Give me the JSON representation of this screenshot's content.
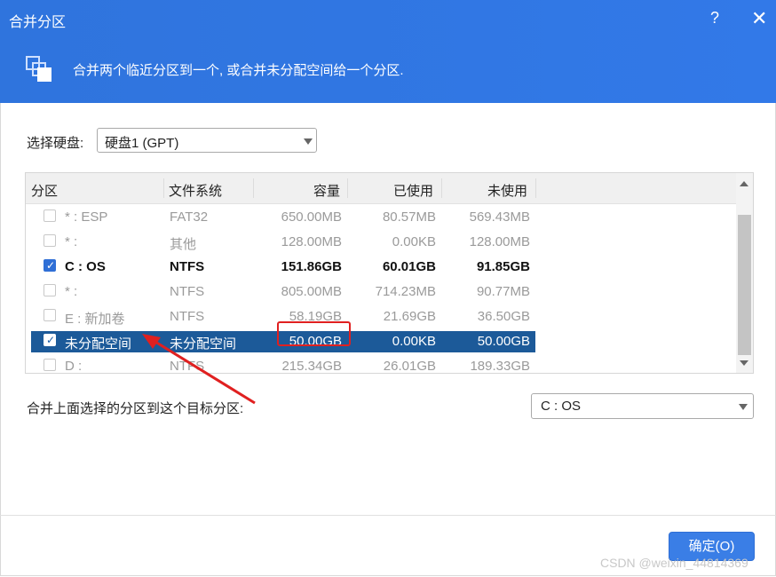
{
  "window": {
    "title": "合并分区",
    "help_icon": "?",
    "close_icon": "✕"
  },
  "banner": {
    "text": "合并两个临近分区到一个, 或合并未分配空间给一个分区."
  },
  "disk": {
    "label": "选择硬盘:",
    "selected": "硬盘1 (GPT)"
  },
  "table": {
    "headers": {
      "partition": "分区",
      "fs": "文件系统",
      "capacity": "容量",
      "used": "已使用",
      "unused": "未使用"
    },
    "rows": [
      {
        "name": "* : ESP",
        "fs": "FAT32",
        "capacity": "650.00MB",
        "used": "80.57MB",
        "unused": "569.43MB",
        "checked": false,
        "state": "disabled"
      },
      {
        "name": "* :",
        "fs": "其他",
        "capacity": "128.00MB",
        "used": "0.00KB",
        "unused": "128.00MB",
        "checked": false,
        "state": "disabled"
      },
      {
        "name": "C :  OS",
        "fs": "NTFS",
        "capacity": "151.86GB",
        "used": "60.01GB",
        "unused": "91.85GB",
        "checked": true,
        "state": "active"
      },
      {
        "name": "* :",
        "fs": "NTFS",
        "capacity": "805.00MB",
        "used": "714.23MB",
        "unused": "90.77MB",
        "checked": false,
        "state": "disabled"
      },
      {
        "name": "E :  新加卷",
        "fs": "NTFS",
        "capacity": "58.19GB",
        "used": "21.69GB",
        "unused": "36.50GB",
        "checked": false,
        "state": "disabled"
      },
      {
        "name": "未分配空间",
        "fs": "未分配空间",
        "capacity": "50.00GB",
        "used": "0.00KB",
        "unused": "50.00GB",
        "checked": true,
        "state": "selected"
      },
      {
        "name": "D :",
        "fs": "NTFS",
        "capacity": "215.34GB",
        "used": "26.01GB",
        "unused": "189.33GB",
        "checked": false,
        "state": "disabled"
      }
    ]
  },
  "target": {
    "label": "合并上面选择的分区到这个目标分区:",
    "selected": "C :  OS"
  },
  "ok_button": "确定(O)",
  "watermark": "CSDN @weixin_44814369",
  "colors": {
    "accent": "#2f74dd",
    "selected_row": "#1c5a99",
    "highlight": "#e02020"
  }
}
